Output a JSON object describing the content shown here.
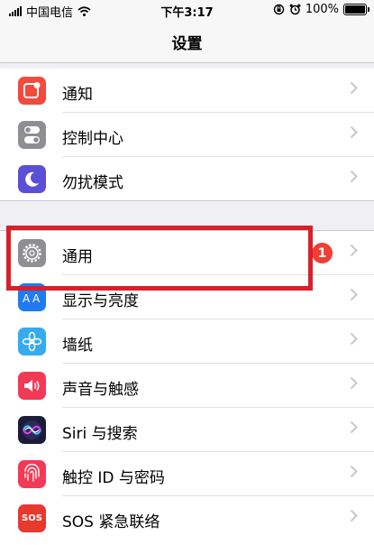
{
  "status_bar": {
    "carrier": "中国电信",
    "time": "下午3:17",
    "battery": "100%"
  },
  "nav": {
    "title": "设置"
  },
  "groups": [
    {
      "items": [
        {
          "label": "通知",
          "icon": "notification-icon",
          "color": "#f24a3d"
        },
        {
          "label": "控制中心",
          "icon": "control-center-icon",
          "color": "#8e8e93"
        },
        {
          "label": "勿扰模式",
          "icon": "moon-icon",
          "color": "#5b4fd6"
        }
      ]
    },
    {
      "items": [
        {
          "label": "通用",
          "icon": "gear-icon",
          "color": "#8e8e93",
          "badge": "1"
        },
        {
          "label": "显示与亮度",
          "icon": "display-brightness-icon",
          "color": "#1f7bf2"
        },
        {
          "label": "墙纸",
          "icon": "wallpaper-flower-icon",
          "color": "#35aaf0"
        },
        {
          "label": "声音与触感",
          "icon": "speaker-icon",
          "color": "#f23a57"
        },
        {
          "label": "Siri 与搜索",
          "icon": "siri-icon",
          "color": "#1c1c3a"
        },
        {
          "label": "触控 ID 与密码",
          "icon": "fingerprint-icon",
          "color": "#f23a57"
        },
        {
          "label": "SOS 紧急联络",
          "icon": "sos-icon",
          "color": "#e8392f",
          "icon_text": "SOS"
        }
      ]
    }
  ],
  "colors": {
    "highlight_box": "#d8202a",
    "badge": "#ef3e32"
  }
}
